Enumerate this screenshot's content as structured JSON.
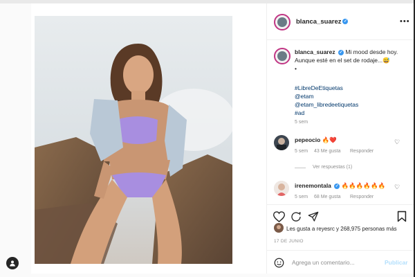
{
  "header": {
    "username": "blanca_suarez",
    "more_label": "•••"
  },
  "caption": {
    "username": "blanca_suarez",
    "text": "Mi mood desde hoy. Aunque esté en el set de rodaje...😅",
    "bullet": "•",
    "tags": [
      "#LibreDeEtiquetas",
      "@etam",
      "@etam_libredeetiquetas",
      "#ad"
    ],
    "time": "5 sem"
  },
  "comments": [
    {
      "username": "pepeocio",
      "text": "🔥❤️",
      "time": "5 sem",
      "likes": "43 Me gusta",
      "reply": "Responder"
    },
    {
      "username": "irenemontala",
      "text": "🔥🔥🔥🔥🔥🔥",
      "time": "5 sem",
      "likes": "68 Me gusta",
      "reply": "Responder"
    }
  ],
  "view_replies": "Ver respuestas (1)",
  "likes_text": "Les gusta a reyesrc y 268,975 personas más",
  "date": "17 DE JUNIO",
  "comment_input": {
    "placeholder": "Agrega un comentario..."
  },
  "post_button": "Publicar",
  "icons": [
    "heart-icon",
    "comment-icon",
    "share-icon",
    "bookmark-icon",
    "emoji-icon",
    "user-icon",
    "verified-icon",
    "more-icon"
  ]
}
